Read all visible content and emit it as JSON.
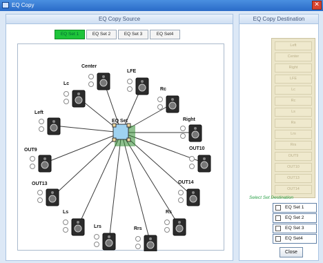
{
  "window": {
    "title": "EQ Copy",
    "close_glyph": "✕"
  },
  "source": {
    "header": "EQ Copy Source",
    "tabs": [
      {
        "label": "EQ Set 1",
        "active": true
      },
      {
        "label": "EQ Set 2",
        "active": false
      },
      {
        "label": "EQ Set 3",
        "active": false
      },
      {
        "label": "EQ Set4",
        "active": false
      }
    ],
    "hub_label": "EQ Set",
    "speakers": [
      {
        "label": "Center"
      },
      {
        "label": "LFE"
      },
      {
        "label": "Rc"
      },
      {
        "label": "Right"
      },
      {
        "label": "OUT10"
      },
      {
        "label": "OUT14"
      },
      {
        "label": "Rs"
      },
      {
        "label": "Rrs"
      },
      {
        "label": "Lrs"
      },
      {
        "label": "Ls"
      },
      {
        "label": "OUT13"
      },
      {
        "label": "OUT9"
      },
      {
        "label": "Left"
      },
      {
        "label": "Lc"
      }
    ]
  },
  "destination": {
    "header": "EQ Copy Destination",
    "channels": [
      "Left",
      "Center",
      "Right",
      "LFE",
      "Lc",
      "Rc",
      "Ls",
      "Rs",
      "Lrs",
      "Rrs",
      "OUT9",
      "OUT10",
      "OUT13",
      "OUT14"
    ],
    "select_label": "Select Set Destination",
    "sets": [
      "EQ Set 1",
      "EQ Set 2",
      "EQ Set 3",
      "EQ Set4"
    ],
    "close_label": "Close"
  },
  "colors": {
    "active_tab": "#1ec43a",
    "titlebar": "#2a6bc8",
    "select_label": "#2ca24a",
    "hub": "#9fd2f0"
  }
}
